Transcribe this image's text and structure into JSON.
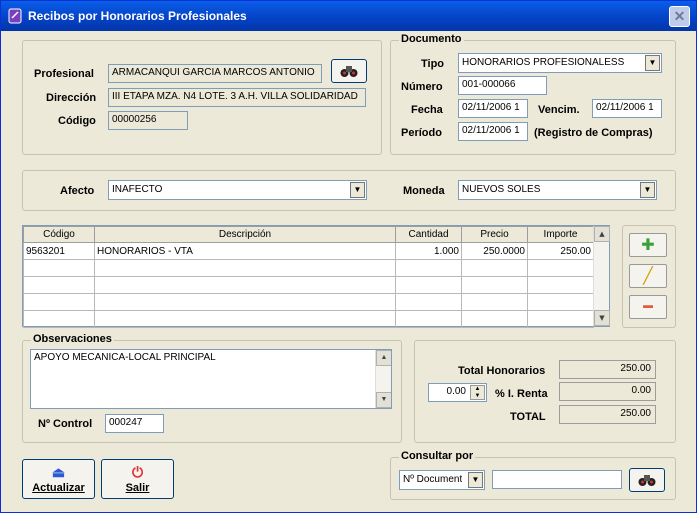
{
  "window": {
    "title": "Recibos por Honorarios Profesionales",
    "close_glyph": "✕"
  },
  "proveedor": {
    "profesional_label": "Profesional",
    "profesional_value": "ARMACANQUI GARCIA MARCOS ANTONIO",
    "direccion_label": "Dirección",
    "direccion_value": "III ETAPA MZA. N4 LOTE. 3 A.H. VILLA SOLIDARIDAD",
    "codigo_label": "Código",
    "codigo_value": "00000256"
  },
  "documento": {
    "legend": "Documento",
    "tipo_label": "Tipo",
    "tipo_value": "HONORARIOS PROFESIONALESS",
    "numero_label": "Número",
    "numero_value": "001-000066",
    "fecha_label": "Fecha",
    "fecha_value": "02/11/2006 1",
    "vencim_label": "Vencim.",
    "vencim_value": "02/11/2006 1",
    "periodo_label": "Período",
    "periodo_value": "02/11/2006 1",
    "registro_note": "(Registro de Compras)"
  },
  "afecto": {
    "label": "Afecto",
    "value": "INAFECTO"
  },
  "moneda": {
    "label": "Moneda",
    "value": "NUEVOS SOLES"
  },
  "grid": {
    "headers": [
      "Código",
      "Descripción",
      "Cantidad",
      "Precio",
      "Importe"
    ],
    "rows": [
      [
        "9563201",
        "HONORARIOS - VTA",
        "1.000",
        "250.0000",
        "250.00"
      ]
    ]
  },
  "observaciones": {
    "legend": "Observaciones",
    "text": "APOYO MECANICA-LOCAL PRINCIPAL"
  },
  "control": {
    "label": "Nº Control",
    "value": "000247"
  },
  "totales": {
    "honorarios_label": "Total Honorarios",
    "honorarios_value": "250.00",
    "renta_pct": "0.00",
    "renta_label": "% I. Renta",
    "renta_value": "0.00",
    "total_label": "TOTAL",
    "total_value": "250.00"
  },
  "buttons": {
    "actualizar": "Actualizar",
    "salir": "Salir"
  },
  "consultar": {
    "legend": "Consultar por",
    "option": "Nº Document",
    "query": ""
  },
  "icons": {
    "binoculars": "binoculars-icon",
    "add": "add-icon",
    "edit": "edit-icon",
    "delete": "delete-icon",
    "save": "save-icon",
    "exit": "power-icon"
  },
  "colors": {
    "titlebar": "#0441c4",
    "window_bg": "#ECE9D8",
    "add": "#3aa03a",
    "delete": "#e05a3a"
  }
}
